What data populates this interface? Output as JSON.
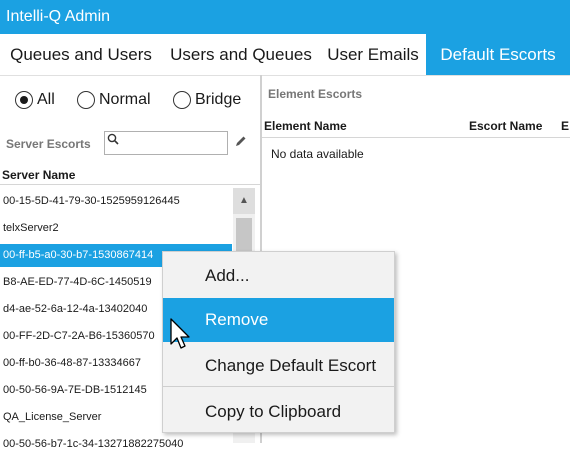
{
  "app": {
    "title": "Intelli-Q Admin"
  },
  "tabs": [
    {
      "label": "Queues and Users",
      "active": false
    },
    {
      "label": "Users and Queues",
      "active": false
    },
    {
      "label": "User Emails",
      "active": false
    },
    {
      "label": "Default Escorts",
      "active": true
    }
  ],
  "filter": {
    "options": [
      {
        "label": "All",
        "selected": true
      },
      {
        "label": "Normal",
        "selected": false
      },
      {
        "label": "Bridge",
        "selected": false
      }
    ]
  },
  "server_panel": {
    "title": "Server Escorts",
    "search": {
      "value": "",
      "placeholder": ""
    },
    "column": "Server Name",
    "rows": [
      "00-15-5D-41-79-30-1525959126445",
      "telxServer2",
      "00-ff-b5-a0-30-b7-1530867414",
      "B8-AE-ED-77-4D-6C-1450519",
      "d4-ae-52-6a-12-4a-13402040",
      "00-FF-2D-C7-2A-B6-15360570",
      "00-ff-b0-36-48-87-13334667",
      "00-50-56-9A-7E-DB-1512145",
      "QA_License_Server",
      "00-50-56-b7-1c-34-13271882275040"
    ],
    "selected_index": 2
  },
  "element_panel": {
    "title": "Element Escorts",
    "columns": [
      "Element Name",
      "Escort Name",
      "E"
    ],
    "empty_text": "No data available"
  },
  "context_menu": {
    "items": [
      {
        "label": "Add...",
        "highlighted": false
      },
      {
        "label": "Remove",
        "highlighted": true
      },
      {
        "label": "Change Default Escort",
        "highlighted": false
      },
      {
        "label": "Copy to Clipboard",
        "highlighted": false
      }
    ]
  },
  "colors": {
    "accent": "#1ba1e2"
  }
}
